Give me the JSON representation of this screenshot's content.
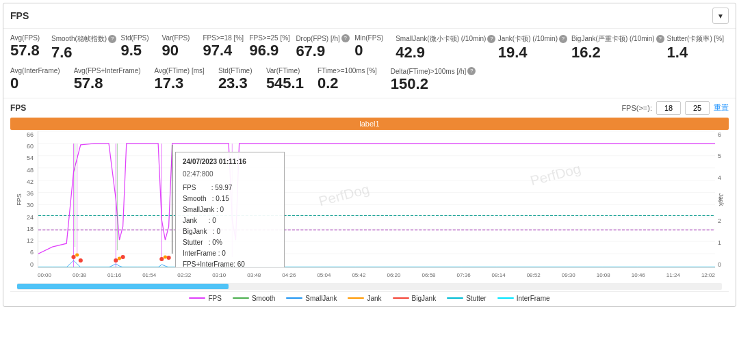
{
  "header": {
    "title": "FPS",
    "dropdown_icon": "▼"
  },
  "metrics_row1": [
    {
      "label": "Avg(FPS)",
      "value": "57.8",
      "has_help": false
    },
    {
      "label": "Smooth(稳帧指数)",
      "value": "7.6",
      "has_help": true
    },
    {
      "label": "Std(FPS)",
      "value": "9.5",
      "has_help": false
    },
    {
      "label": "Var(FPS)",
      "value": "90",
      "has_help": false
    },
    {
      "label": "FPS>=18 [%]",
      "value": "97.4",
      "has_help": false
    },
    {
      "label": "FPS>=25 [%]",
      "value": "96.9",
      "has_help": false
    },
    {
      "label": "Drop(FPS) [/h]",
      "value": "67.9",
      "has_help": true
    },
    {
      "label": "Min(FPS)",
      "value": "0",
      "has_help": false
    },
    {
      "label": "SmallJank(微小卡顿) (/10min)",
      "value": "42.9",
      "has_help": true
    },
    {
      "label": "Jank(卡顿) (/10min)",
      "value": "19.4",
      "has_help": true
    },
    {
      "label": "BigJank(严重卡顿) (/10min)",
      "value": "16.2",
      "has_help": true
    },
    {
      "label": "Stutter(卡频率) [%]",
      "value": "1.4",
      "has_help": false
    }
  ],
  "metrics_row2": [
    {
      "label": "Avg(InterFrame)",
      "value": "0",
      "has_help": false
    },
    {
      "label": "Avg(FPS+InterFrame)",
      "value": "57.8",
      "has_help": false
    },
    {
      "label": "Avg(FTime) [ms]",
      "value": "17.3",
      "has_help": false
    },
    {
      "label": "Std(FTime)",
      "value": "23.3",
      "has_help": false
    },
    {
      "label": "Var(FTime)",
      "value": "545.1",
      "has_help": false
    },
    {
      "label": "FTime>=100ms [%]",
      "value": "0.2",
      "has_help": false
    },
    {
      "label": "Delta(FTime)>100ms [/h]",
      "value": "150.2",
      "has_help": true
    }
  ],
  "chart": {
    "title": "FPS",
    "fps_gte_label": "FPS(>=):",
    "fps_val1": "18",
    "fps_val2": "25",
    "reset_label": "重置",
    "label_bar_text": "label1",
    "y_axis_left": [
      "66",
      "60",
      "54",
      "48",
      "42",
      "36",
      "30",
      "24",
      "18",
      "12",
      "6",
      "0"
    ],
    "y_axis_right": [
      "6",
      "5",
      "4",
      "3",
      "2",
      "1",
      "0"
    ],
    "x_axis": [
      "00:00",
      "00:38",
      "01:16",
      "01:54",
      "02:32",
      "03:10",
      "03:48",
      "04:26",
      "05:04",
      "05:42",
      "06:20",
      "06:58",
      "07:36",
      "08:14",
      "08:52",
      "09:30",
      "10:08",
      "10:46",
      "11:24",
      "12:02"
    ],
    "fps_left_label": "FPS",
    "jank_right_label": "Jank",
    "tooltip": {
      "time": "24/07/2023 01:11:16",
      "time2": "02:47:800",
      "fps": "59.97",
      "smooth": "0.15",
      "smalljank": "0",
      "jank": "0",
      "bigjank": "0",
      "stutter": "0%",
      "interframe": "0",
      "fps_interframe": "60"
    }
  },
  "legend": [
    {
      "label": "FPS",
      "color": "#e040fb",
      "type": "line"
    },
    {
      "label": "Smooth",
      "color": "#4caf50",
      "type": "line"
    },
    {
      "label": "SmallJank",
      "color": "#2196f3",
      "type": "line"
    },
    {
      "label": "Jank",
      "color": "#ff9800",
      "type": "line"
    },
    {
      "label": "BigJank",
      "color": "#f44336",
      "type": "line"
    },
    {
      "label": "Stutter",
      "color": "#00bcd4",
      "type": "line"
    },
    {
      "label": "InterFrame",
      "color": "#00e5ff",
      "type": "line"
    }
  ]
}
